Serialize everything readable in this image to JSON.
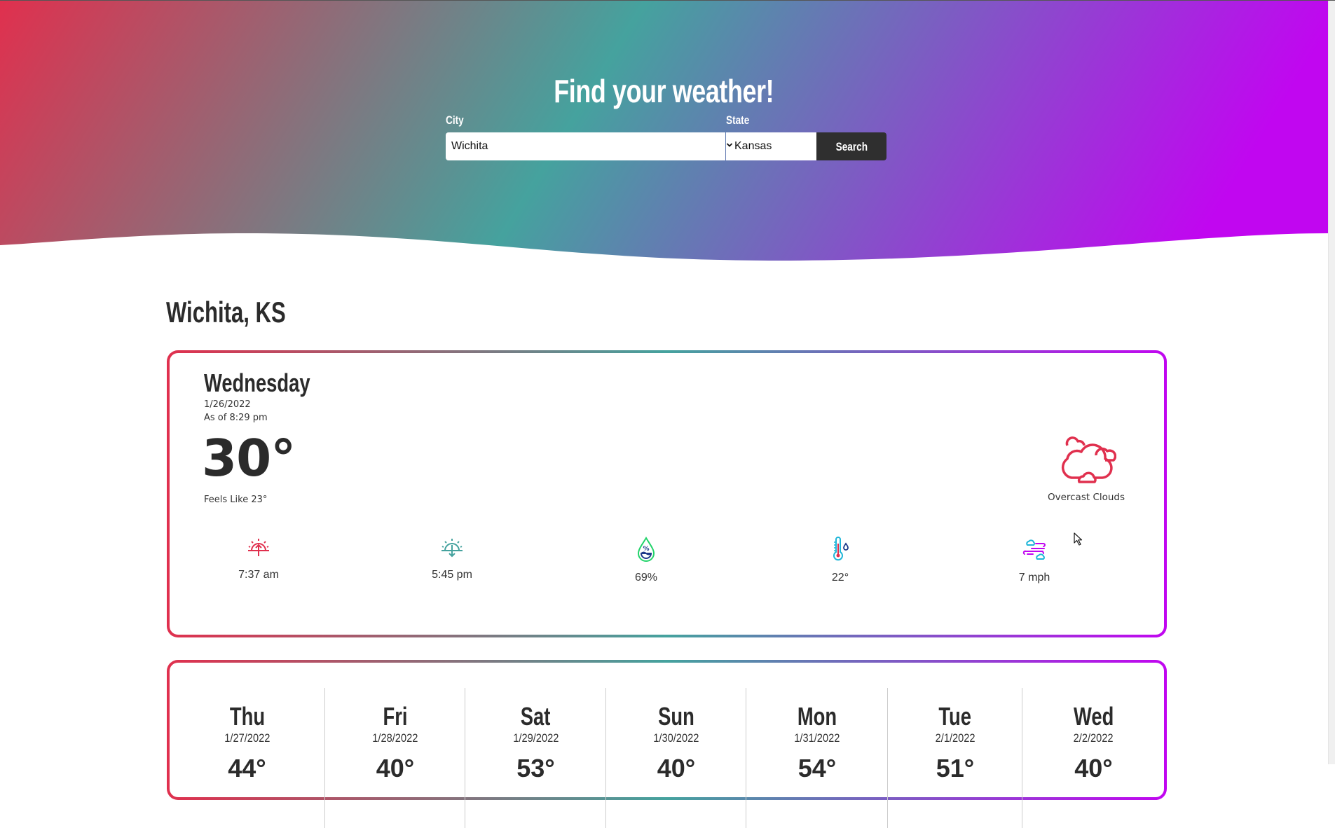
{
  "header": {
    "title": "Find your weather!",
    "city_label": "City",
    "city_value": "Wichita",
    "state_label": "State",
    "state_selected": "Kansas",
    "search_label": "Search"
  },
  "location": "Wichita, KS",
  "current": {
    "day": "Wednesday",
    "date": "1/26/2022",
    "as_of": "As of 8:29 pm",
    "temperature": "30°",
    "feels_like": "Feels Like 23°",
    "condition": "Overcast Clouds",
    "condition_icon": "clouds-icon",
    "stats": [
      {
        "icon": "sunrise-icon",
        "value": "7:37 am"
      },
      {
        "icon": "sunset-icon",
        "value": "5:45 pm"
      },
      {
        "icon": "humidity-icon",
        "value": "69%"
      },
      {
        "icon": "dew-point-thermometer-icon",
        "value": "22°"
      },
      {
        "icon": "wind-icon",
        "value": "7 mph"
      }
    ]
  },
  "forecast": [
    {
      "day": "Thu",
      "date": "1/27/2022",
      "temp": "44°"
    },
    {
      "day": "Fri",
      "date": "1/28/2022",
      "temp": "40°"
    },
    {
      "day": "Sat",
      "date": "1/29/2022",
      "temp": "53°"
    },
    {
      "day": "Sun",
      "date": "1/30/2022",
      "temp": "40°"
    },
    {
      "day": "Mon",
      "date": "1/31/2022",
      "temp": "54°"
    },
    {
      "day": "Tue",
      "date": "2/1/2022",
      "temp": "51°"
    },
    {
      "day": "Wed",
      "date": "2/2/2022",
      "temp": "40°"
    }
  ],
  "colors": {
    "gradient_start": "#e0304e",
    "gradient_mid": "#45a29e",
    "gradient_end": "#c106f0",
    "button_bg": "#2f2f2f"
  }
}
